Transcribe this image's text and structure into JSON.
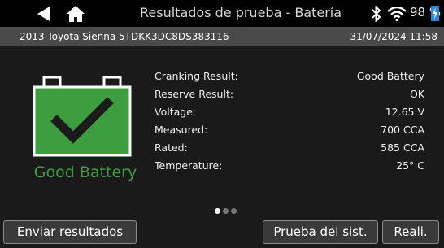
{
  "header": {
    "title": "Resultados de prueba - Batería",
    "battery_percent": "98 %"
  },
  "info": {
    "vehicle": "2013 Toyota Sienna  5TDKK3DC8DS383116",
    "datetime": "31/07/2024 11:58"
  },
  "status": {
    "label": "Good Battery",
    "color": "#3d9e3f"
  },
  "results": [
    {
      "label": "Cranking Result:",
      "value": "Good Battery"
    },
    {
      "label": "Reserve Result:",
      "value": "OK"
    },
    {
      "label": "Voltage:",
      "value": "12.65 V"
    },
    {
      "label": "Measured:",
      "value": "700 CCA"
    },
    {
      "label": "Rated:",
      "value": "585 CCA"
    },
    {
      "label": "Temperature:",
      "value": "25° C"
    }
  ],
  "pager": {
    "count": 3,
    "active": 1
  },
  "buttons": {
    "send": "Enviar resultados",
    "system": "Prueba del sist.",
    "reali": "Reali."
  },
  "icons": {
    "back": "back-arrow-icon",
    "home": "home-icon",
    "bluetooth": "bluetooth-icon",
    "wifi": "wifi-icon",
    "charging": "charging-icon",
    "battery_status": "battery-check-icon"
  }
}
